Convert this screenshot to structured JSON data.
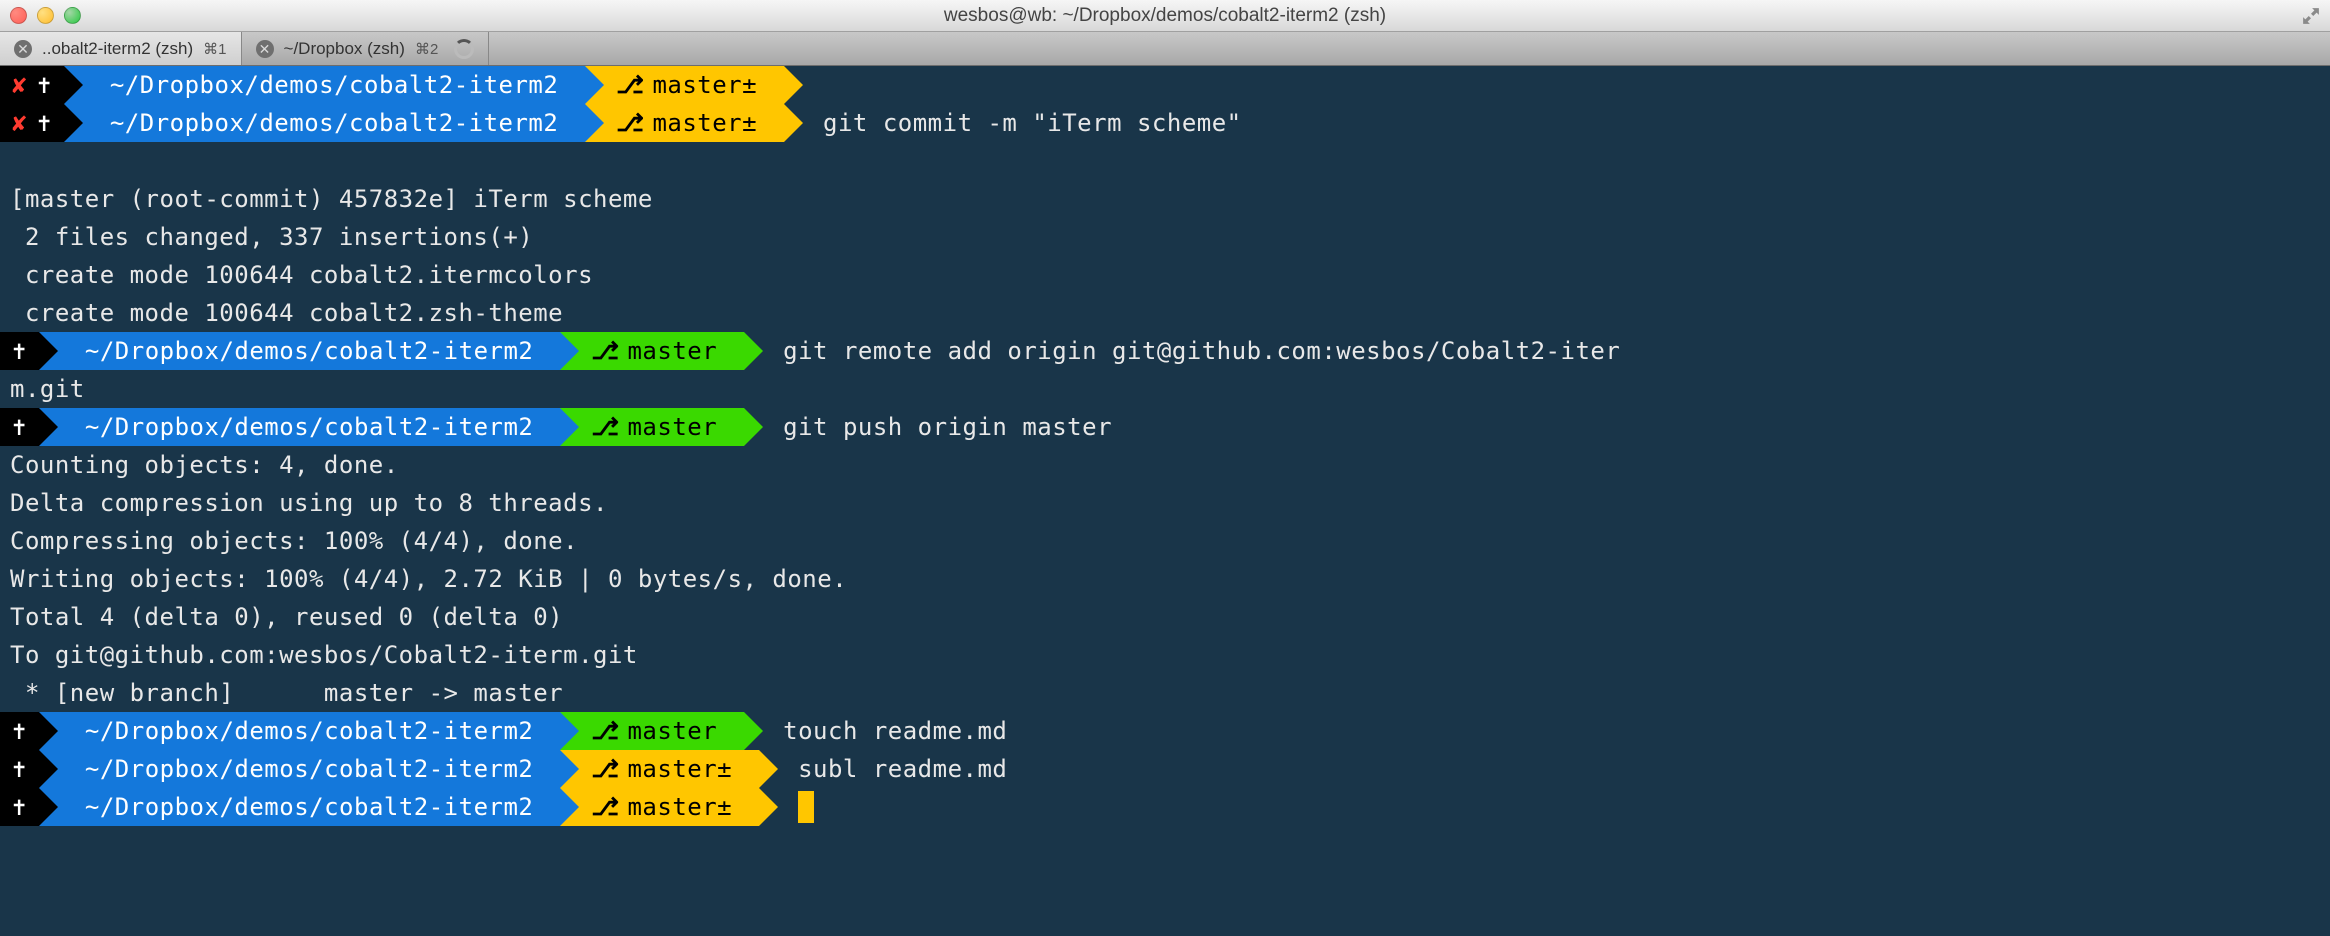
{
  "window": {
    "title": "wesbos@wb: ~/Dropbox/demos/cobalt2-iterm2 (zsh)"
  },
  "tabs": [
    {
      "label": "..obalt2-iterm2 (zsh)",
      "shortcut": "⌘1",
      "active": true
    },
    {
      "label": "~/Dropbox (zsh)",
      "shortcut": "⌘2",
      "active": false,
      "busy": true
    }
  ],
  "colors": {
    "bg": "#193549",
    "blue": "#1478db",
    "yellow": "#ffc600",
    "green": "#3ad900",
    "black": "#000000"
  },
  "cwd": "~/Dropbox/demos/cobalt2-iterm2",
  "branch_symbol": "⎇",
  "lines": [
    {
      "type": "prompt",
      "status": "fail",
      "path": "~/Dropbox/demos/cobalt2-iterm2",
      "branch": "master",
      "dirty": true,
      "branch_color": "yellow",
      "cmd": ""
    },
    {
      "type": "prompt",
      "status": "fail",
      "path": "~/Dropbox/demos/cobalt2-iterm2",
      "branch": "master",
      "dirty": true,
      "branch_color": "yellow",
      "cmd": "git commit -m \"iTerm scheme\""
    },
    {
      "type": "blank"
    },
    {
      "type": "text",
      "text": "[master (root-commit) 457832e] iTerm scheme"
    },
    {
      "type": "text",
      "text": " 2 files changed, 337 insertions(+)"
    },
    {
      "type": "text",
      "text": " create mode 100644 cobalt2.itermcolors"
    },
    {
      "type": "text",
      "text": " create mode 100644 cobalt2.zsh-theme"
    },
    {
      "type": "prompt",
      "status": "ok",
      "path": "~/Dropbox/demos/cobalt2-iterm2",
      "branch": "master",
      "dirty": false,
      "branch_color": "green",
      "cmd": "git remote add origin git@github.com:wesbos/Cobalt2-iter"
    },
    {
      "type": "text",
      "text": "m.git"
    },
    {
      "type": "prompt",
      "status": "ok",
      "path": "~/Dropbox/demos/cobalt2-iterm2",
      "branch": "master",
      "dirty": false,
      "branch_color": "green",
      "cmd": "git push origin master"
    },
    {
      "type": "text",
      "text": "Counting objects: 4, done."
    },
    {
      "type": "text",
      "text": "Delta compression using up to 8 threads."
    },
    {
      "type": "text",
      "text": "Compressing objects: 100% (4/4), done."
    },
    {
      "type": "text",
      "text": "Writing objects: 100% (4/4), 2.72 KiB | 0 bytes/s, done."
    },
    {
      "type": "text",
      "text": "Total 4 (delta 0), reused 0 (delta 0)"
    },
    {
      "type": "text",
      "text": "To git@github.com:wesbos/Cobalt2-iterm.git"
    },
    {
      "type": "text",
      "text": " * [new branch]      master -> master"
    },
    {
      "type": "prompt",
      "status": "ok",
      "path": "~/Dropbox/demos/cobalt2-iterm2",
      "branch": "master",
      "dirty": false,
      "branch_color": "green",
      "cmd": "touch readme.md"
    },
    {
      "type": "prompt",
      "status": "ok",
      "path": "~/Dropbox/demos/cobalt2-iterm2",
      "branch": "master",
      "dirty": true,
      "branch_color": "yellow",
      "cmd": "subl readme.md"
    },
    {
      "type": "prompt",
      "status": "ok",
      "path": "~/Dropbox/demos/cobalt2-iterm2",
      "branch": "master",
      "dirty": true,
      "branch_color": "yellow",
      "cmd": "",
      "cursor": true
    }
  ]
}
